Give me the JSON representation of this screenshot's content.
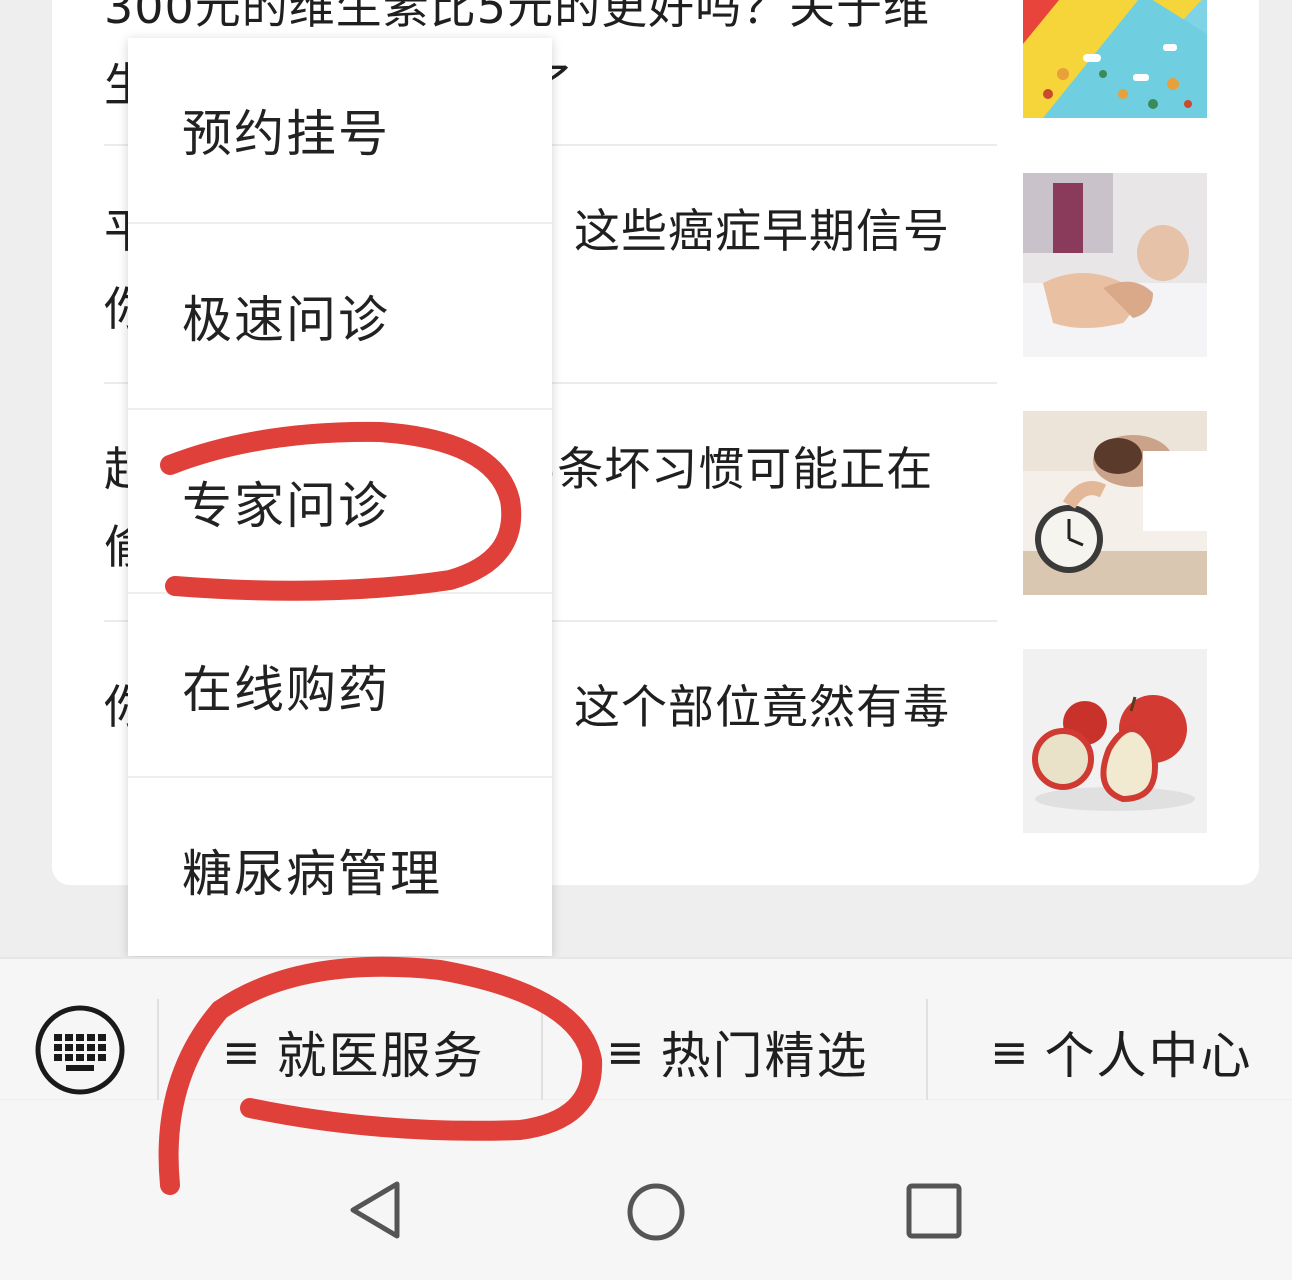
{
  "articles": [
    {
      "title": "300元的维生素比5元的更好吗？关于维生素的那些事说清楚了"
    },
    {
      "title": "平时不注意这些癌症！这些癌症早期信号你知道几个？"
    },
    {
      "title": "起夜多还睡不着？这5条坏习惯可能正在偷走你的睡眠"
    },
    {
      "title": "你以为吃苹果很健康？这个部位竟然有毒"
    }
  ],
  "menu": {
    "items": [
      {
        "label": "预约挂号"
      },
      {
        "label": "极速问诊"
      },
      {
        "label": "专家问诊"
      },
      {
        "label": "在线购药"
      },
      {
        "label": "糖尿病管理"
      }
    ]
  },
  "tabbar": {
    "hamburger": "≡",
    "tabs": [
      {
        "label": "就医服务"
      },
      {
        "label": "热门精选"
      },
      {
        "label": "个人中心"
      }
    ]
  },
  "icons": {
    "keyboard": "keyboard-icon",
    "back": "back-triangle-icon",
    "home": "home-circle-icon",
    "recents": "recents-square-icon"
  },
  "colors": {
    "annotation": "#e0403a",
    "background": "#eeeeee"
  }
}
